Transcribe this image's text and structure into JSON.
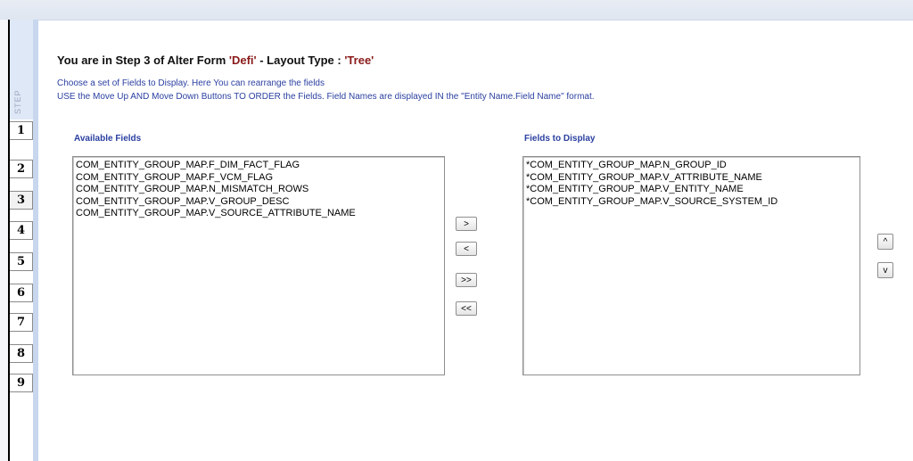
{
  "header": {
    "title_prefix": "You are in Step 3 of Alter Form ",
    "form_name": "'Defi'",
    "title_mid": " -  Layout Type : ",
    "layout_type": "'Tree'"
  },
  "description": {
    "line1": "Choose a set of Fields to Display. Here You can rearrange the fields",
    "line2": "USE the Move Up AND Move Down Buttons TO ORDER the Fields. Field Names are displayed IN the \"Entity Name.Field Name\" format."
  },
  "steps": {
    "label": "STEP",
    "items": [
      "1",
      "2",
      "3",
      "4",
      "5",
      "6",
      "7",
      "8",
      "9"
    ],
    "active": "3"
  },
  "available": {
    "label": "Available Fields",
    "items": [
      "COM_ENTITY_GROUP_MAP.F_DIM_FACT_FLAG",
      "COM_ENTITY_GROUP_MAP.F_VCM_FLAG",
      "COM_ENTITY_GROUP_MAP.N_MISMATCH_ROWS",
      "COM_ENTITY_GROUP_MAP.V_GROUP_DESC",
      "COM_ENTITY_GROUP_MAP.V_SOURCE_ATTRIBUTE_NAME"
    ]
  },
  "display": {
    "label": "Fields to Display",
    "items": [
      "*COM_ENTITY_GROUP_MAP.N_GROUP_ID",
      "*COM_ENTITY_GROUP_MAP.V_ATTRIBUTE_NAME",
      "*COM_ENTITY_GROUP_MAP.V_ENTITY_NAME",
      "*COM_ENTITY_GROUP_MAP.V_SOURCE_SYSTEM_ID"
    ]
  },
  "buttons": {
    "move_right": ">",
    "move_left": "<",
    "move_all_right": ">>",
    "move_all_left": "<<",
    "move_up": "^",
    "move_down": "v"
  }
}
